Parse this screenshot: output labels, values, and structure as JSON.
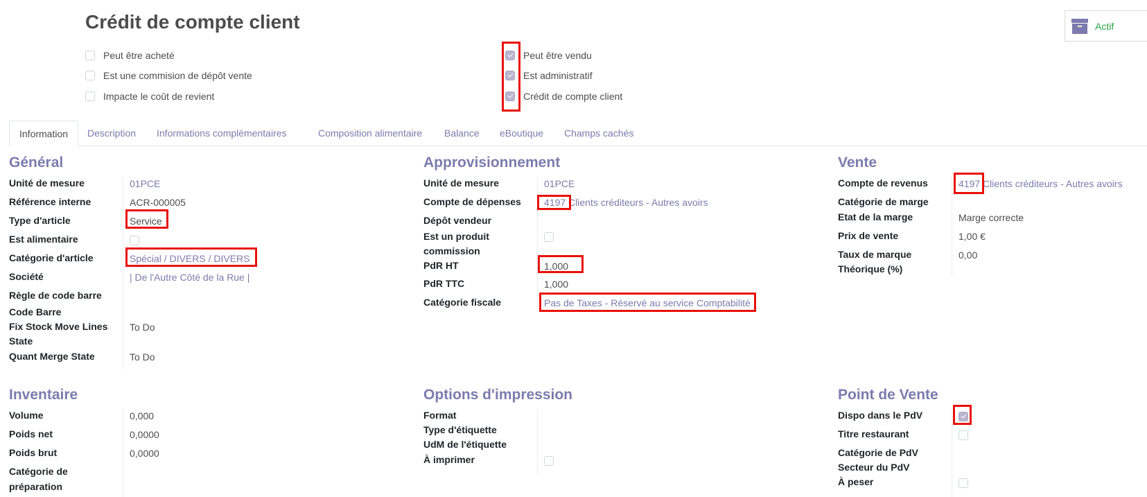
{
  "title": "Crédit de compte client",
  "status": {
    "label": "Actif",
    "icon": "archive-icon"
  },
  "checkboxes": [
    {
      "label": "Peut être acheté",
      "checked": false
    },
    {
      "label": "Est une commision de dépôt vente",
      "checked": false
    },
    {
      "label": "Impacte le coût de revient",
      "checked": false
    },
    {
      "label": "Peut être vendu",
      "checked": true
    },
    {
      "label": "Est administratif",
      "checked": true
    },
    {
      "label": "Crédit de compte client",
      "checked": true
    }
  ],
  "tabs": [
    "Information",
    "Description",
    "Informations complémentaires",
    "Composition alimentaire",
    "Balance",
    "eBoutique",
    "Champs cachés"
  ],
  "general": {
    "title": "Général",
    "fields": [
      {
        "label": "Unité de mesure",
        "value": "01PCE"
      },
      {
        "label": "Référence interne",
        "value": "ACR-000005"
      },
      {
        "label": "Type d'article",
        "value": "Service"
      },
      {
        "label": "Est alimentaire",
        "checked": false
      },
      {
        "label": "Catégorie d'article",
        "value": "Spécial / DIVERS / DIVERS"
      },
      {
        "label": "Société",
        "value": "| De l'Autre Côté de la Rue |"
      },
      {
        "label": "Règle de code barre",
        "value": ""
      },
      {
        "label": "Code Barre",
        "value": ""
      },
      {
        "label_line1": "Fix Stock Move Lines",
        "label_line2": "State",
        "value": "To Do"
      },
      {
        "label": "Quant Merge State",
        "value": "To Do"
      }
    ]
  },
  "approvisionnement": {
    "title": "Approvisionnement",
    "fields": [
      {
        "label": "Unité de mesure",
        "value": "01PCE"
      },
      {
        "label": "Compte de dépenses",
        "code": "4197",
        "value": "Clients créditeurs - Autres avoirs"
      },
      {
        "label": "Dépôt vendeur",
        "value": ""
      },
      {
        "label_line1": "Est un produit",
        "label_line2": "commission",
        "checked": false
      },
      {
        "label": "PdR HT",
        "value": "1,000"
      },
      {
        "label": "PdR TTC",
        "value": "1,000"
      },
      {
        "label": "Catégorie fiscale",
        "value": "Pas de Taxes - Réservé au service Comptabilité"
      }
    ]
  },
  "vente": {
    "title": "Vente",
    "fields": [
      {
        "label": "Compte de revenus",
        "code": "4197",
        "value": "Clients créditeurs - Autres avoirs"
      },
      {
        "label": "Catégorie de marge",
        "value": ""
      },
      {
        "label": "Etat de la marge",
        "value": "Marge correcte"
      },
      {
        "label": "Prix de vente",
        "value": "1,00 €"
      },
      {
        "label_line1": "Taux de marque",
        "label_line2": "Théorique (%)",
        "value": "0,00"
      }
    ]
  },
  "inventaire": {
    "title": "Inventaire",
    "fields": [
      {
        "label": "Volume",
        "value": "0,000"
      },
      {
        "label": "Poids net",
        "value": "0,0000"
      },
      {
        "label": "Poids brut",
        "value": "0,0000"
      },
      {
        "label_line1": "Catégorie de",
        "label_line2": "préparation",
        "value": ""
      }
    ]
  },
  "impression": {
    "title": "Options d'impression",
    "fields": [
      {
        "label": "Format"
      },
      {
        "label": "Type d'étiquette"
      },
      {
        "label": "UdM de l'étiquette"
      },
      {
        "label": "À imprimer",
        "checked": false
      }
    ]
  },
  "pdv": {
    "title": "Point de Vente",
    "fields": [
      {
        "label": "Dispo dans le PdV",
        "checked": true
      },
      {
        "label": "Titre restaurant",
        "checked": false
      },
      {
        "label": "Catégorie de PdV"
      },
      {
        "label": "Secteur du PdV"
      },
      {
        "label": "À peser",
        "checked": false
      }
    ]
  }
}
